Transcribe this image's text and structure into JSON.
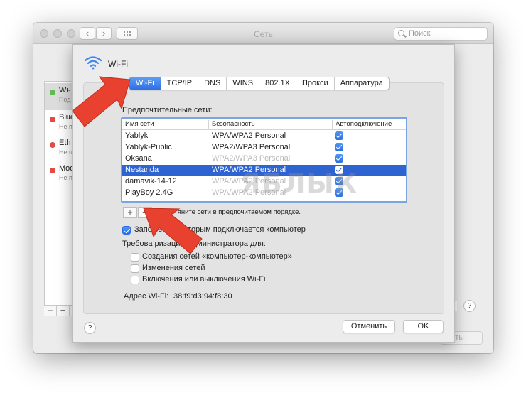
{
  "window": {
    "title": "Сеть",
    "search_placeholder": "Поиск",
    "nav_back": "‹",
    "nav_forward": "›",
    "apply_label": "нить"
  },
  "services": [
    {
      "name": "Wi-",
      "status": "Под",
      "color": "#5ebd4f"
    },
    {
      "name": "Blue",
      "status": "Не п",
      "color": "#e24b45"
    },
    {
      "name": "Eth",
      "status": "Не п",
      "color": "#e24b45"
    },
    {
      "name": "Mod",
      "status": "Не п",
      "color": "#e24b45"
    }
  ],
  "list_buttons": {
    "add": "+",
    "remove": "−"
  },
  "sheet": {
    "title": "Wi-Fi",
    "tabs": [
      "Wi-Fi",
      "TCP/IP",
      "DNS",
      "WINS",
      "802.1X",
      "Прокси",
      "Аппаратура"
    ],
    "active_tab": "Wi-Fi",
    "preferred_label": "Предпочтительные сети:",
    "columns": [
      "Имя сети",
      "Безопасность",
      "Автоподключение"
    ],
    "networks": [
      {
        "name": "Yablyk",
        "security": "WPA/WPA2 Personal",
        "faded": false,
        "auto": true
      },
      {
        "name": "Yablyk-Public",
        "security": "WPA2/WPA3 Personal",
        "faded": false,
        "auto": true
      },
      {
        "name": "Oksana",
        "security": "WPA2/WPA3 Personal",
        "faded": true,
        "auto": true
      },
      {
        "name": "Nestanda",
        "security": "WPA/WPA2 Personal",
        "faded": false,
        "auto": true,
        "selected": true
      },
      {
        "name": "damavik-14-12",
        "security": "WPA/WPA2 Personal",
        "faded": true,
        "auto": true
      },
      {
        "name": "PlayBoy 2.4G",
        "security": "WPA/WPA2 Personal",
        "faded": true,
        "auto": true
      }
    ],
    "add_btn": "+",
    "remove_btn": "−",
    "drag_hint": "Перетяните сети в предпочитаемом порядке.",
    "remember_label": "Запо         сети, к которым подключается компьютер",
    "admin_label": "Требова        ризацию администратора для:",
    "admin_options": [
      {
        "label": "Создания сетей «компьютер-компьютер»",
        "checked": false
      },
      {
        "label": "Изменения сетей",
        "checked": false
      },
      {
        "label": "Включения или выключения Wi-Fi",
        "checked": false
      }
    ],
    "address_label": "Адрес Wi-Fi:",
    "address_value": "38:f9:d3:94:f8:30",
    "help": "?",
    "cancel": "Отменить",
    "ok": "OK"
  },
  "watermark": "ЯБЛЫК",
  "accent_color": "#2e63d2",
  "arrow_color": "#e8412f"
}
